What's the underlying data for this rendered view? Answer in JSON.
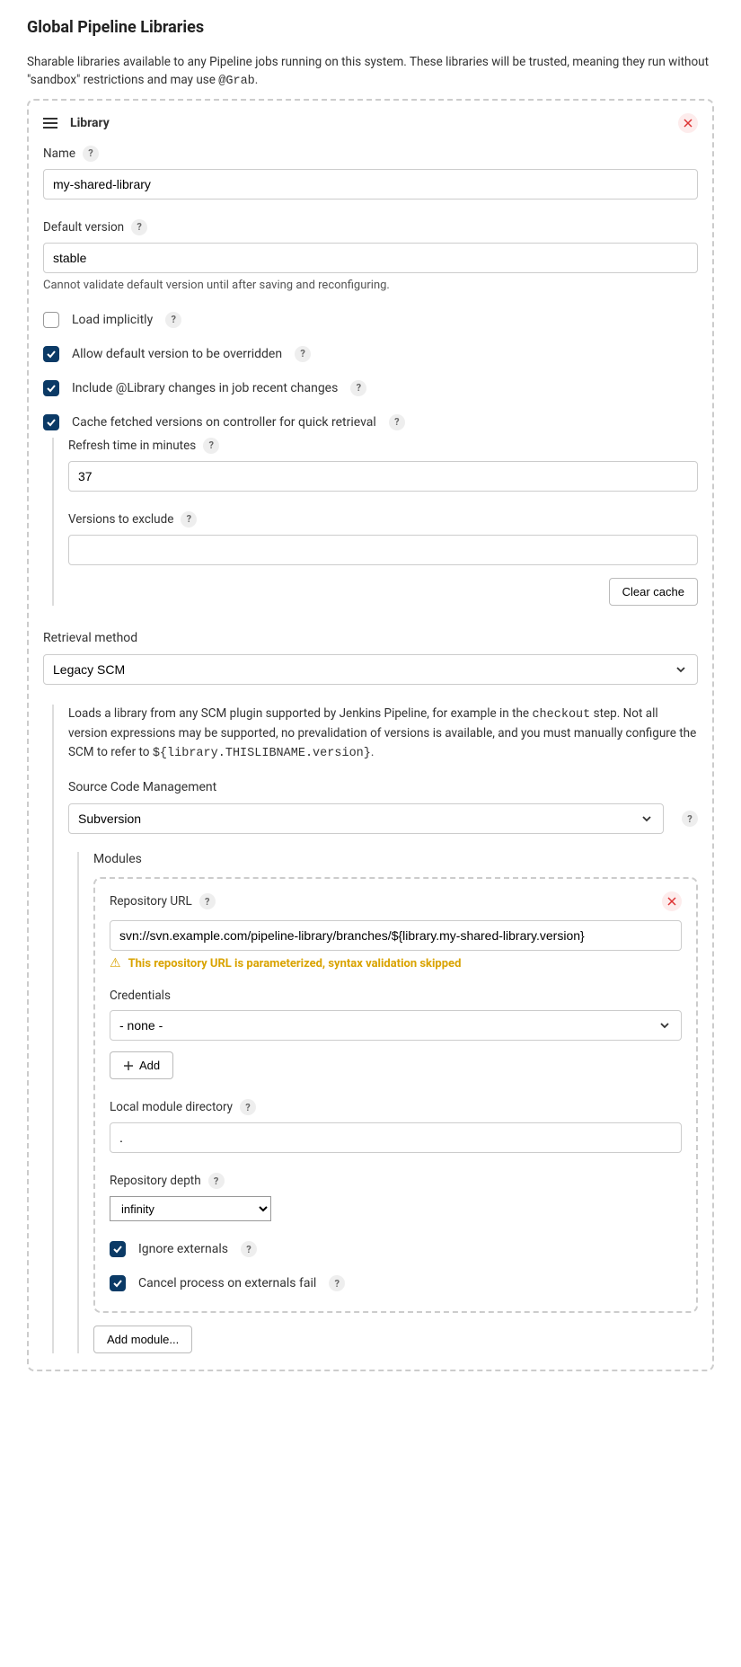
{
  "page": {
    "title": "Global Pipeline Libraries",
    "intro_pre": "Sharable libraries available to any Pipeline jobs running on this system. These libraries will be trusted, meaning they run without \"sandbox\" restrictions and may use ",
    "intro_code": "@Grab",
    "intro_post": "."
  },
  "library": {
    "header": "Library",
    "name_label": "Name",
    "name_value": "my-shared-library",
    "default_version_label": "Default version",
    "default_version_value": "stable",
    "default_version_hint": "Cannot validate default version until after saving and reconfiguring.",
    "load_implicitly_label": "Load implicitly",
    "allow_override_label": "Allow default version to be overridden",
    "include_changes_label": "Include @Library changes in job recent changes",
    "cache_label": "Cache fetched versions on controller for quick retrieval",
    "refresh_label": "Refresh time in minutes",
    "refresh_value": "37",
    "versions_exclude_label": "Versions to exclude",
    "versions_exclude_value": "",
    "clear_cache_btn": "Clear cache"
  },
  "retrieval": {
    "label": "Retrieval method",
    "selected": "Legacy SCM",
    "description_pre": "Loads a library from any SCM plugin supported by Jenkins Pipeline, for example in the ",
    "description_code1": "checkout",
    "description_mid": " step. Not all version expressions may be supported, no prevalidation of versions is available, and you must manually configure the SCM to refer to ",
    "description_code2": "${library.THISLIBNAME.version}",
    "description_post": ".",
    "scm_label": "Source Code Management",
    "scm_selected": "Subversion"
  },
  "modules": {
    "title": "Modules",
    "repo_url_label": "Repository URL",
    "repo_url_value": "svn://svn.example.com/pipeline-library/branches/${library.my-shared-library.version}",
    "repo_warning": "This repository URL is parameterized, syntax validation skipped",
    "credentials_label": "Credentials",
    "credentials_selected": "- none -",
    "add_btn": "Add",
    "local_dir_label": "Local module directory",
    "local_dir_value": ".",
    "depth_label": "Repository depth",
    "depth_selected": "infinity",
    "ignore_externals_label": "Ignore externals",
    "cancel_externals_label": "Cancel process on externals fail",
    "add_module_btn": "Add module..."
  }
}
